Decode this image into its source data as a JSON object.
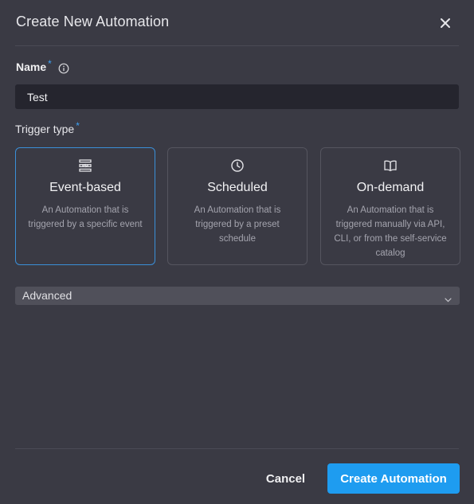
{
  "dialog": {
    "title": "Create New Automation",
    "close_icon": "close-icon"
  },
  "name_field": {
    "label": "Name",
    "required_marker": "*",
    "info_icon": "info-icon",
    "value": "Test"
  },
  "trigger": {
    "label": "Trigger type",
    "required_marker": "*",
    "options": [
      {
        "icon": "event-stack-icon",
        "title": "Event-based",
        "description": "An Automation that is triggered by a specific event",
        "selected": true
      },
      {
        "icon": "clock-icon",
        "title": "Scheduled",
        "description": "An Automation that is triggered by a preset schedule",
        "selected": false
      },
      {
        "icon": "book-icon",
        "title": "On-demand",
        "description": "An Automation that is triggered manually via API, CLI, or from the self-service catalog",
        "selected": false
      }
    ]
  },
  "advanced": {
    "label": "Advanced",
    "chevron_icon": "chevron-down-icon"
  },
  "footer": {
    "cancel_label": "Cancel",
    "create_label": "Create Automation"
  },
  "colors": {
    "background": "#3a3a44",
    "accent": "#1e9cf0",
    "selected_border": "#3a8fd8",
    "input_bg": "#25252e"
  }
}
